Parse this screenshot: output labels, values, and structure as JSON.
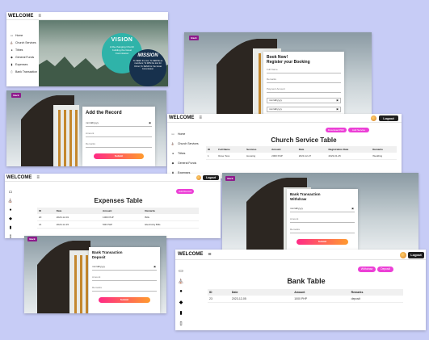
{
  "brand": "WELCOME",
  "logout": "Logout",
  "sidebar": {
    "home": "Home",
    "church": "Church Services",
    "tithes": "Tithes",
    "general": "General Funds",
    "expenses": "Expenses",
    "bank": "Bank Transaction"
  },
  "hero": {
    "vision_title": "VISION",
    "vision_text": "A life-changing Church building the Great Commission",
    "mission_title": "MISSION",
    "mission_text": "To SEEK the lost; To SERVE as members; To WIN the lost for Christ; To SEND for the Great Commission"
  },
  "back_label": "Back",
  "booking": {
    "title_line1": "Book Now!",
    "title_line2": "Register your Booking",
    "full_name": "Full Name",
    "remarks": "Remarks",
    "payment": "Payment Amount",
    "date1": "mm/dd/yyyy",
    "date2": "mm/dd/yyyy"
  },
  "record": {
    "title": "Add the Record",
    "date": "mm/dd/yyyy",
    "amount": "Amount",
    "remarks": "Remarks",
    "submit": "Submit"
  },
  "church_table": {
    "title": "Church Service Table",
    "download_btn": "Download PDF",
    "add_btn": "Add Service",
    "headers": [
      "ID",
      "Full Name",
      "Services",
      "Amount",
      "Date",
      "Registration Date",
      "Remarks"
    ],
    "rows": [
      [
        "1",
        "Rose Tess",
        "Housing",
        "2000 PHP",
        "2023-12-27",
        "2023-01-25",
        "Wedding"
      ]
    ]
  },
  "expenses_table": {
    "title": "Expenses Table",
    "add_btn": "Add Record",
    "headers": [
      "ID",
      "Date",
      "Amount",
      "Remarks"
    ],
    "rows": [
      [
        "20",
        "2023-12-01",
        "1000 PHP",
        "Bills"
      ],
      [
        "21",
        "2023-12-15",
        "500 PHP",
        "Electricity Bills"
      ]
    ]
  },
  "withdraw": {
    "title_line1": "Bank Transaction",
    "title_line2": "Withdraw",
    "date": "mm/dd/yyyy",
    "amount": "Amount",
    "remarks": "Remarks",
    "submit": "Submit"
  },
  "deposit": {
    "title_line1": "Bank Transaction",
    "title_line2": "Deposit",
    "date": "mm/dd/yyyy",
    "amount": "Amount",
    "remarks": "Remarks",
    "submit": "Submit"
  },
  "bank_table": {
    "title": "Bank Table",
    "withdraw_btn": "Withdraw",
    "deposit_btn": "Deposit",
    "headers": [
      "ID",
      "Date",
      "Amount",
      "Remarks"
    ],
    "rows": [
      [
        "23",
        "2023-12-05",
        "1000 PHP",
        "deposit"
      ]
    ]
  }
}
